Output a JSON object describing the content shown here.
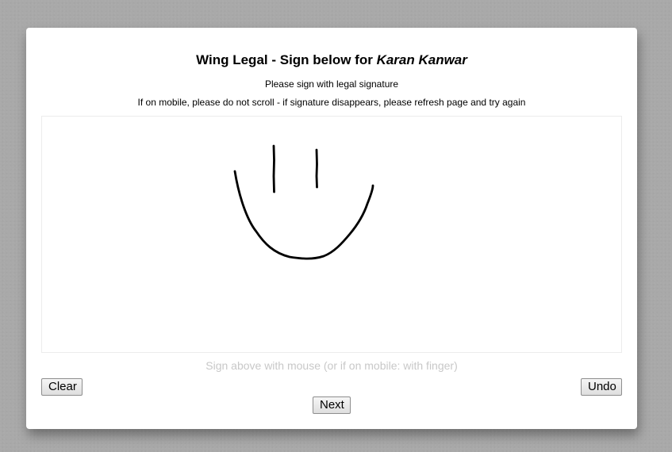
{
  "header": {
    "title_prefix": "Wing Legal - Sign below for ",
    "signer_name": "Karan Kanwar",
    "instruction": "Please sign with legal signature",
    "mobile_note": "If on mobile, please do not scroll - if signature disappears, please refresh page and try again"
  },
  "signature_pad": {
    "hint": "Sign above with mouse (or if on mobile: with finger)",
    "stroke_color": "#000000"
  },
  "buttons": {
    "clear_label": "Clear",
    "undo_label": "Undo",
    "next_label": "Next"
  }
}
